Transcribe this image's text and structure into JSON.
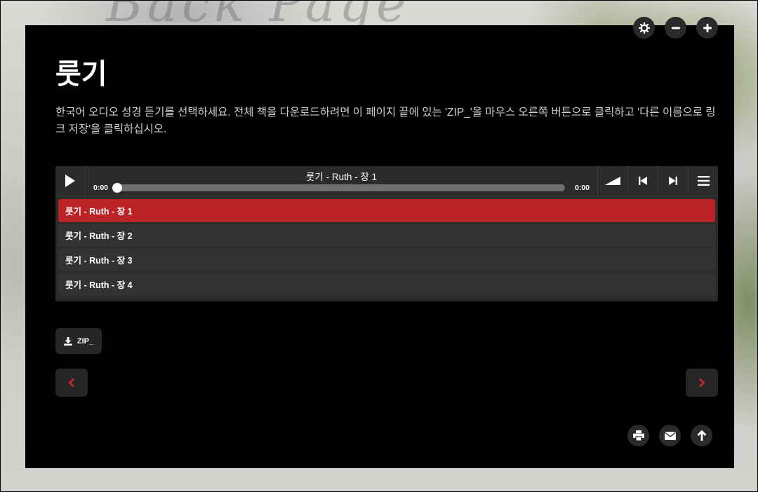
{
  "page": {
    "title": "룻기",
    "intro": "한국어 오디오 성경 듣기를 선택하세요. 전체 책을 다운로드하려면 이 페이지 끝에 있는 'ZIP_'을 마우스 오른쪽 버튼으로 클릭하고 '다른 이름으로 링크 저장'을 클릭하십시오."
  },
  "player": {
    "now_playing": "룻기 - Ruth - 장 1",
    "current_time": "0:00",
    "duration": "0:00",
    "progress": 0,
    "playlist": [
      {
        "label": "룻기 - Ruth - 장 1",
        "active": true
      },
      {
        "label": "룻기 - Ruth - 장 2",
        "active": false
      },
      {
        "label": "룻기 - Ruth - 장 3",
        "active": false
      },
      {
        "label": "룻기 - Ruth - 장 4",
        "active": false
      }
    ]
  },
  "download": {
    "zip_label": "ZIP_"
  },
  "icons": {
    "top": [
      "settings-icon",
      "zoom-out-icon",
      "zoom-in-icon"
    ],
    "player": [
      "play-icon",
      "volume-icon",
      "previous-track-icon",
      "next-track-icon",
      "playlist-menu-icon"
    ],
    "nav": [
      "chevron-left-icon",
      "chevron-right-icon"
    ],
    "bottom": [
      "print-icon",
      "mail-icon",
      "arrow-up-icon"
    ]
  },
  "colors": {
    "accent": "#bb2327",
    "card": "#000000",
    "button": "#262626"
  }
}
